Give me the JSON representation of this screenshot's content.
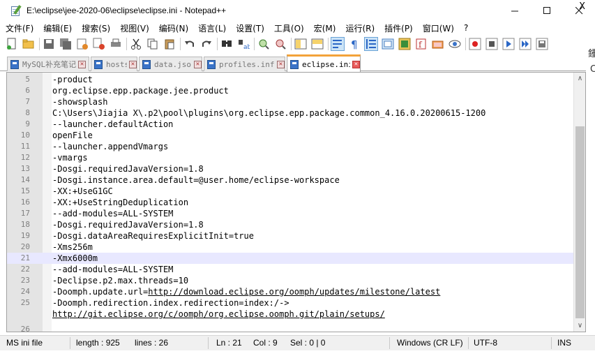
{
  "window": {
    "title": "E:\\eclipse\\jee-2020-06\\eclipse\\eclipse.ini - Notepad++",
    "minimize": "–",
    "maximize": "☐",
    "close": "✕"
  },
  "menu": {
    "items": [
      "文件(F)",
      "编辑(E)",
      "搜索(S)",
      "视图(V)",
      "编码(N)",
      "语言(L)",
      "设置(T)",
      "工具(O)",
      "宏(M)",
      "运行(R)",
      "插件(P)",
      "窗口(W)",
      "?"
    ],
    "close_doc": "X"
  },
  "background_glyphs": [
    "鍾",
    "C"
  ],
  "tabs": [
    {
      "label": "MySQL补充笔记",
      "close": "✕",
      "active": false
    },
    {
      "label": "hosts",
      "close": "✕",
      "active": false
    },
    {
      "label": "data.json",
      "close": "✕",
      "active": false
    },
    {
      "label": "profiles.info",
      "close": "✕",
      "active": false
    },
    {
      "label": "eclipse.ini",
      "close": "✕",
      "active": true
    }
  ],
  "editor": {
    "current_line": 21,
    "lines": [
      {
        "n": "5",
        "text": "-product"
      },
      {
        "n": "6",
        "text": "org.eclipse.epp.package.jee.product"
      },
      {
        "n": "7",
        "text": "-showsplash"
      },
      {
        "n": "8",
        "text": "C:\\Users\\Jiajia X\\.p2\\pool\\plugins\\org.eclipse.epp.package.common_4.16.0.20200615-1200"
      },
      {
        "n": "9",
        "text": "--launcher.defaultAction"
      },
      {
        "n": "10",
        "text": "openFile"
      },
      {
        "n": "11",
        "text": "--launcher.appendVmargs"
      },
      {
        "n": "12",
        "text": "-vmargs"
      },
      {
        "n": "13",
        "text": "-Dosgi.requiredJavaVersion=1.8"
      },
      {
        "n": "14",
        "text": "-Dosgi.instance.area.default=@user.home/eclipse-workspace"
      },
      {
        "n": "15",
        "text": "-XX:+UseG1GC"
      },
      {
        "n": "16",
        "text": "-XX:+UseStringDeduplication"
      },
      {
        "n": "17",
        "text": "--add-modules=ALL-SYSTEM"
      },
      {
        "n": "18",
        "text": "-Dosgi.requiredJavaVersion=1.8"
      },
      {
        "n": "19",
        "text": "-Dosgi.dataAreaRequiresExplicitInit=true"
      },
      {
        "n": "20",
        "text": "-Xms256m"
      },
      {
        "n": "21",
        "text": "-Xmx6000m"
      },
      {
        "n": "22",
        "text": "--add-modules=ALL-SYSTEM"
      },
      {
        "n": "23",
        "text": "-Declipse.p2.max.threads=10"
      },
      {
        "n": "24",
        "text": "-Doomph.update.url=",
        "link": "http://download.eclipse.org/oomph/updates/milestone/latest"
      },
      {
        "n": "25",
        "text": "-Doomph.redirection.index.redirection=index:/->"
      },
      {
        "n": "",
        "text": "",
        "link": "http://git.eclipse.org/c/oomph/org.eclipse.oomph.git/plain/setups/"
      },
      {
        "n": "26",
        "text": ""
      }
    ]
  },
  "scrollbar": {
    "up": "∧",
    "down": "∨"
  },
  "status": {
    "language": "MS ini file",
    "length": "length : 925",
    "lines": "lines : 26",
    "ln": "Ln : 21",
    "col": "Col : 9",
    "sel": "Sel : 0 | 0",
    "eol": "Windows (CR LF)",
    "encoding": "UTF-8",
    "mode": "INS"
  },
  "toolbar_icons": [
    "new-file-icon",
    "open-file-icon",
    "save-icon",
    "save-all-icon",
    "close-icon",
    "close-all-icon",
    "print-icon",
    "cut-icon",
    "copy-icon",
    "paste-icon",
    "undo-icon",
    "redo-icon",
    "find-icon",
    "replace-icon",
    "zoom-in-icon",
    "zoom-out-icon",
    "sync-vertical-icon",
    "sync-horizontal-icon",
    "word-wrap-icon",
    "show-all-chars-icon",
    "indent-guide-icon",
    "udl-icon",
    "doc-map-icon",
    "function-list-icon",
    "folder-workspace-icon",
    "monitor-icon",
    "record-macro-icon",
    "stop-macro-icon",
    "play-macro-icon",
    "run-macro-multiple-icon",
    "save-macro-icon"
  ]
}
